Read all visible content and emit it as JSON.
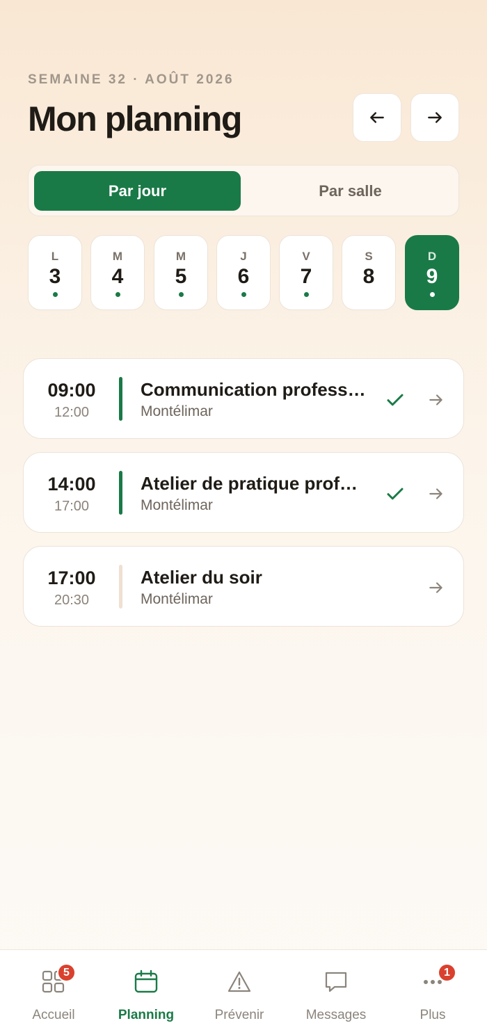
{
  "header": {
    "week_label": "SEMAINE 32 · AOÛT 2026",
    "title": "Mon planning",
    "prev_icon": "arrow-left-icon",
    "next_icon": "arrow-right-icon"
  },
  "view_toggle": {
    "by_day": "Par jour",
    "by_room": "Par salle",
    "selected": "by_day"
  },
  "days": [
    {
      "letter": "L",
      "number": "3",
      "has_sessions": true,
      "selected": false
    },
    {
      "letter": "M",
      "number": "4",
      "has_sessions": true,
      "selected": false
    },
    {
      "letter": "M",
      "number": "5",
      "has_sessions": true,
      "selected": false
    },
    {
      "letter": "J",
      "number": "6",
      "has_sessions": true,
      "selected": false
    },
    {
      "letter": "V",
      "number": "7",
      "has_sessions": true,
      "selected": false
    },
    {
      "letter": "S",
      "number": "8",
      "has_sessions": false,
      "selected": false
    },
    {
      "letter": "D",
      "number": "9",
      "has_sessions": true,
      "selected": true
    }
  ],
  "sessions": [
    {
      "start": "09:00",
      "end": "12:00",
      "title": "Communication professionnelle",
      "place": "Montélimar",
      "confirmed": true
    },
    {
      "start": "14:00",
      "end": "17:00",
      "title": "Atelier de pratique professionnelle",
      "place": "Montélimar",
      "confirmed": true
    },
    {
      "start": "17:00",
      "end": "20:30",
      "title": "Atelier du soir",
      "place": "Montélimar",
      "confirmed": false
    }
  ],
  "tabbar": {
    "tabs": [
      {
        "label": "Accueil",
        "icon": "grid-icon",
        "badge": "5",
        "active": false
      },
      {
        "label": "Planning",
        "icon": "calendar-icon",
        "badge": null,
        "active": true
      },
      {
        "label": "Prévenir",
        "icon": "warning-triangle-icon",
        "badge": null,
        "active": false
      },
      {
        "label": "Messages",
        "icon": "message-icon",
        "badge": null,
        "active": false
      },
      {
        "label": "Plus",
        "icon": "more-dots-icon",
        "badge": "1",
        "active": false
      }
    ]
  },
  "colors": {
    "accent": "#1a7a47",
    "badge": "#d9412e",
    "pending_bar": "#efe0d2"
  }
}
